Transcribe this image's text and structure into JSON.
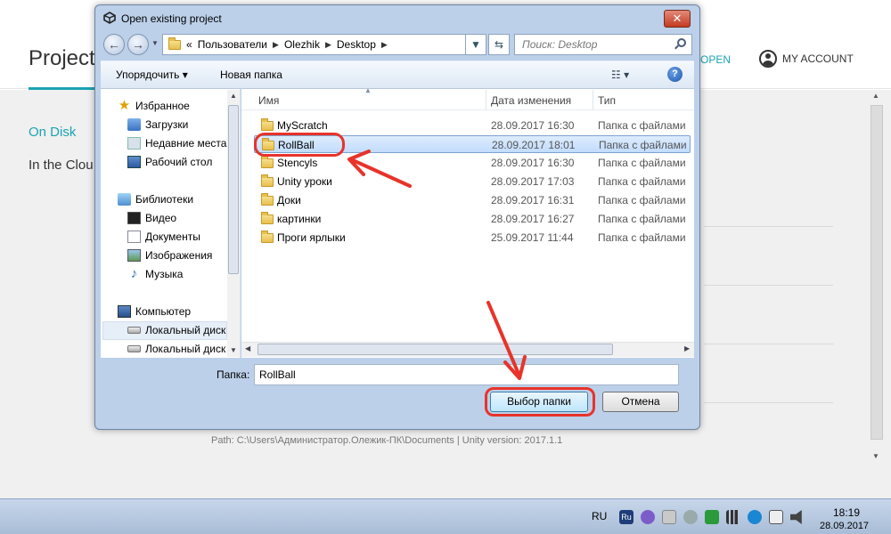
{
  "hub": {
    "title": "Project",
    "open_label": "OPEN",
    "account_label": "MY ACCOUNT",
    "tab_on_disk": "On Disk",
    "tab_cloud": "In the Clou",
    "path_line": "Path: C:\\Users\\Администратор.Олежик-ПК\\Documents | Unity version: 2017.1.1"
  },
  "dialog": {
    "title": "Open existing project",
    "breadcrumb": [
      "«",
      "Пользователи",
      "Olezhik",
      "Desktop"
    ],
    "search_placeholder": "Поиск: Desktop",
    "toolbar": {
      "organize": "Упорядочить ▾",
      "new_folder": "Новая папка",
      "help": "?"
    },
    "nav": {
      "favorites": "Избранное",
      "downloads": "Загрузки",
      "recent": "Недавние места",
      "desktop": "Рабочий стол",
      "libraries": "Библиотеки",
      "video": "Видео",
      "documents": "Документы",
      "images": "Изображения",
      "music": "Музыка",
      "computer": "Компьютер",
      "disk_c": "Локальный диск",
      "disk_d": "Локальный диск"
    },
    "columns": {
      "name": "Имя",
      "date": "Дата изменения",
      "type": "Тип"
    },
    "files": [
      {
        "name": "MyScratch",
        "date": "28.09.2017 16:30",
        "type": "Папка с файлами"
      },
      {
        "name": "RollBall",
        "date": "28.09.2017 18:01",
        "type": "Папка с файлами"
      },
      {
        "name": "Stencyls",
        "date": "28.09.2017 16:30",
        "type": "Папка с файлами"
      },
      {
        "name": "Unity уроки",
        "date": "28.09.2017 17:03",
        "type": "Папка с файлами"
      },
      {
        "name": "Доки",
        "date": "28.09.2017 16:31",
        "type": "Папка с файлами"
      },
      {
        "name": "картинки",
        "date": "28.09.2017 16:27",
        "type": "Папка с файлами"
      },
      {
        "name": "Проги ярлыки",
        "date": "25.09.2017 11:44",
        "type": "Папка с файлами"
      }
    ],
    "selected_file": "RollBall",
    "folder_label": "Папка:",
    "folder_value": "RollBall",
    "select_button": "Выбор папки",
    "cancel_button": "Отмена"
  },
  "taskbar": {
    "lang": "RU",
    "time": "18:19",
    "date": "28.09.2017"
  },
  "colors": {
    "accent": "#1aa3b3",
    "annotation": "#e8332a"
  }
}
